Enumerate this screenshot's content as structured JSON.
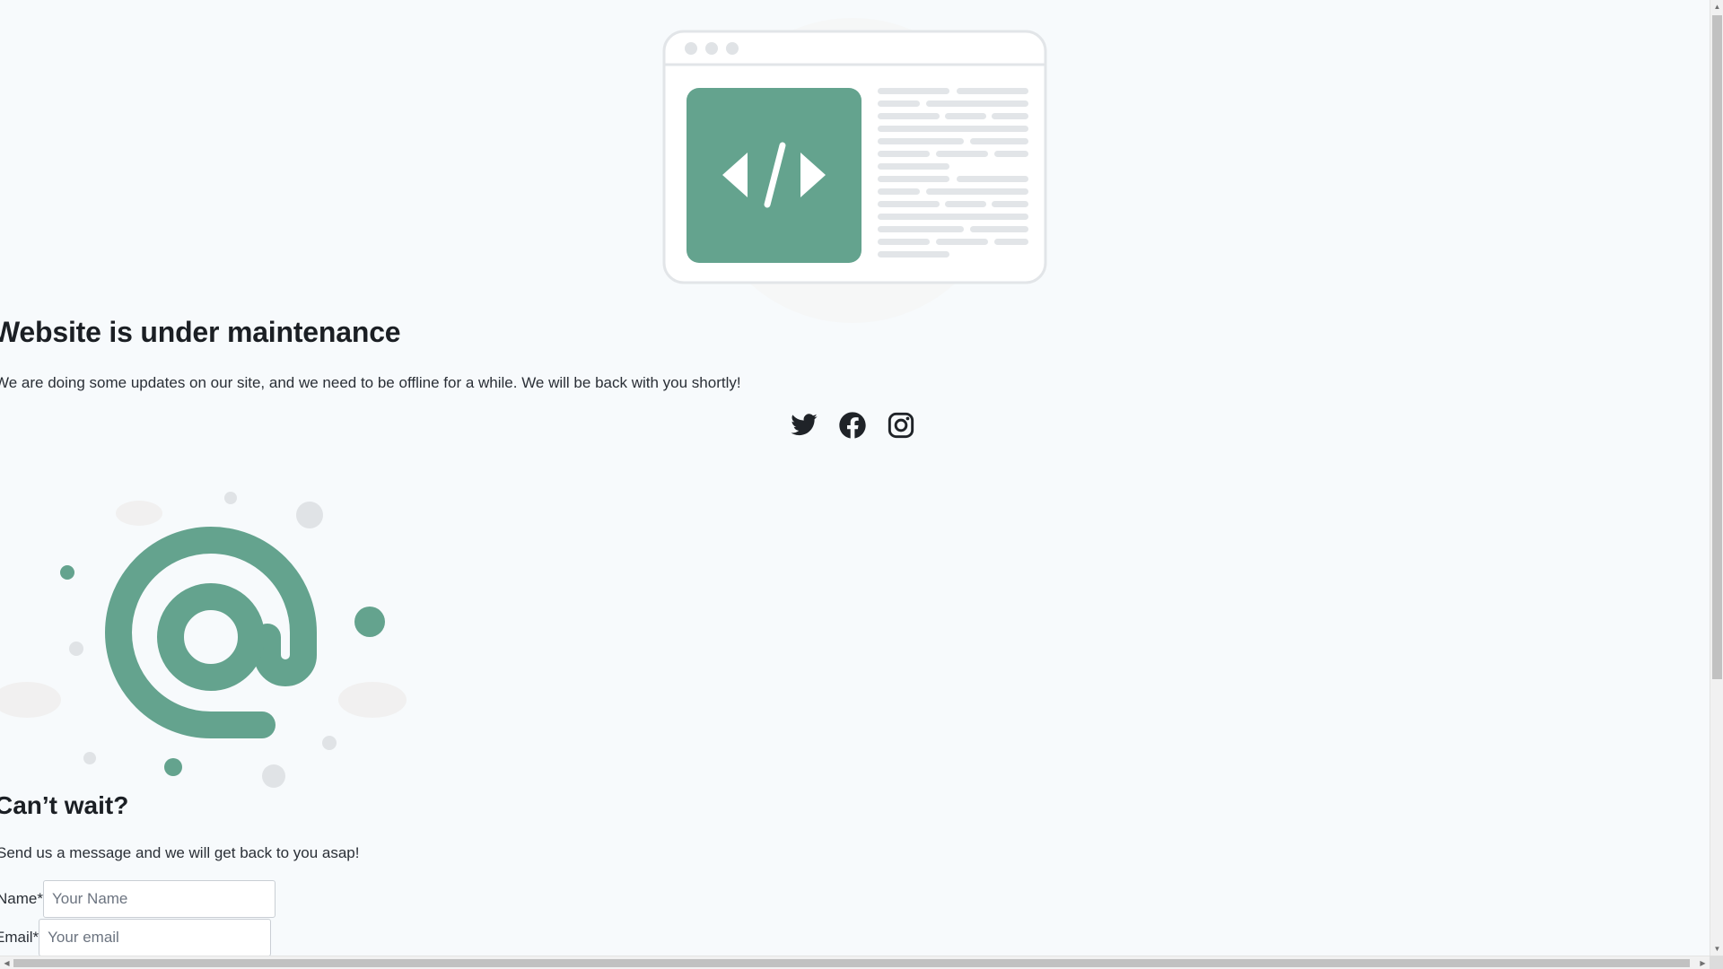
{
  "page": {
    "headline": "Website is under maintenance",
    "lead": "We are doing some updates on our site, and we need to be offline for a while. We will be back with you shortly!",
    "social": [
      {
        "name": "twitter-icon"
      },
      {
        "name": "facebook-icon"
      },
      {
        "name": "instagram-icon"
      }
    ]
  },
  "contact": {
    "title": "Can’t wait?",
    "subtitle": "Send us a message and we will get back to you asap!",
    "name_label": "Name*",
    "name_placeholder": "Your Name",
    "email_label": "Email*",
    "email_placeholder": "Your email"
  },
  "colors": {
    "accent": "#64a38e",
    "background": "#f7fafc",
    "text": "#1f2328"
  },
  "icons": {
    "maintenance_illustration": "browser-code-window-icon",
    "contact_illustration": "at-sign-icon"
  }
}
